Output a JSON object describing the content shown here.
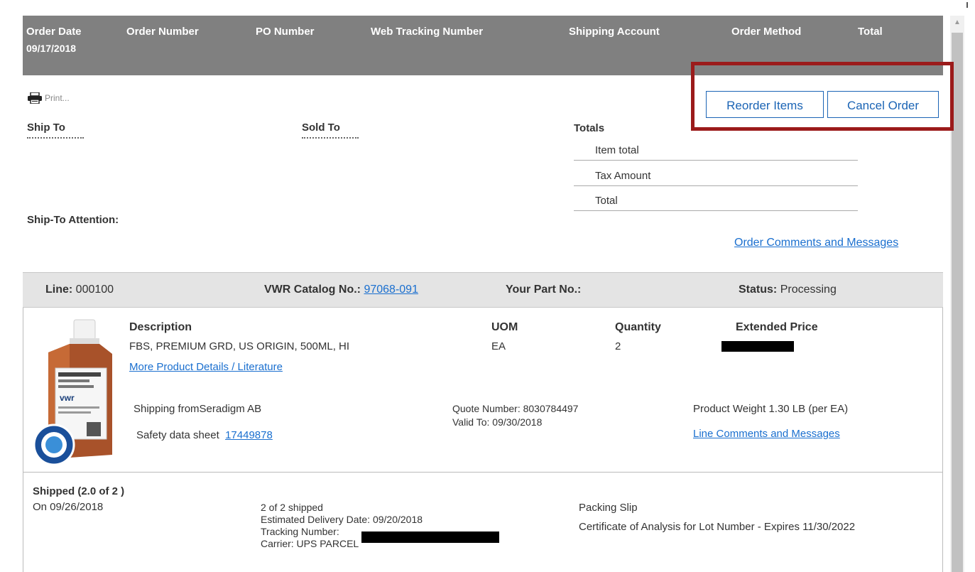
{
  "order_header": {
    "columns": [
      "Order Date",
      "Order Number",
      "PO Number",
      "Web Tracking Number",
      "Shipping Account",
      "Order Method",
      "Total"
    ],
    "order_date": "09/17/2018"
  },
  "actions": {
    "print": "Print...",
    "reorder": "Reorder Items",
    "cancel": "Cancel Order"
  },
  "addresses": {
    "ship_to": "Ship To",
    "sold_to": "Sold To",
    "ship_to_attention": "Ship-To Attention:"
  },
  "totals": {
    "heading": "Totals",
    "rows": [
      "Item total",
      "Tax Amount",
      "Total"
    ]
  },
  "order_comments_link": "Order Comments and Messages",
  "line_item": {
    "line_label": "Line:",
    "line_value": "000100",
    "catalog_label": "VWR Catalog No.:",
    "catalog_value": "97068-091",
    "part_label": "Your Part No.:",
    "status_label": "Status:",
    "status_value": "Processing",
    "headers": {
      "description": "Description",
      "uom": "UOM",
      "quantity": "Quantity",
      "extended_price": "Extended Price"
    },
    "description": "FBS, PREMIUM GRD, US ORIGIN, 500ML, HI",
    "uom": "EA",
    "quantity": "2",
    "details_link": "More Product Details / Literature",
    "shipping_from": "Shipping fromSeradigm AB",
    "safety_label": "Safety data sheet",
    "safety_link": "17449878",
    "quote_number": "Quote Number: 8030784497",
    "valid_to": "Valid To: 09/30/2018",
    "weight": "Product Weight 1.30 LB (per EA)",
    "line_comments_link": "Line Comments and Messages"
  },
  "shipment": {
    "heading": "Shipped (2.0 of 2 )",
    "date": "On 09/26/2018",
    "shipped_count": "2 of 2 shipped",
    "estimated_delivery": "Estimated Delivery Date: 09/20/2018",
    "tracking_label": "Tracking Number:",
    "carrier": "Carrier: UPS PARCEL",
    "packing_slip": "Packing Slip",
    "certificate": "Certificate of Analysis for Lot Number  - Expires  11/30/2022"
  },
  "colors": {
    "header_bg": "#808080",
    "link": "#1a6fcf",
    "button_border": "#1b64b5",
    "highlight": "#9b1b1b",
    "line_band": "#e4e4e4"
  }
}
